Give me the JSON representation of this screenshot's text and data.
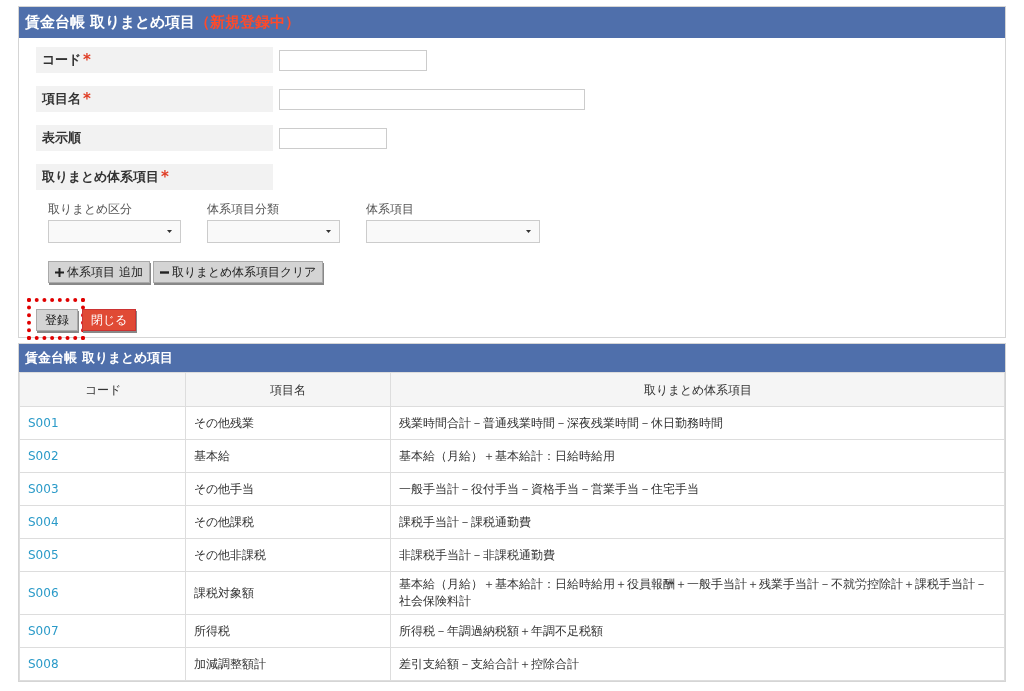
{
  "form_panel": {
    "title": "賃金台帳 取りまとめ項目",
    "status": "（新規登録中）",
    "fields": [
      {
        "label": "コード",
        "required_mark": "*",
        "kind": "input"
      },
      {
        "label": "項目名",
        "required_mark": "*",
        "kind": "input"
      },
      {
        "label": "表示順",
        "kind": "input"
      },
      {
        "label": "取りまとめ体系項目",
        "required_mark": "*",
        "kind": "group"
      }
    ],
    "selects": [
      {
        "label": "取りまとめ区分"
      },
      {
        "label": "体系項目分類"
      },
      {
        "label": "体系項目"
      }
    ],
    "action_buttons": [
      {
        "label": "体系項目 追加",
        "kind": "add"
      },
      {
        "label": "取りまとめ体系項目クリア",
        "kind": "clear"
      }
    ],
    "footer_buttons": [
      {
        "label": "登録",
        "kind": "default",
        "highlighted": true
      },
      {
        "label": "閉じる",
        "kind": "danger",
        "highlighted": false
      }
    ]
  },
  "list_panel": {
    "title": "賃金台帳 取りまとめ項目",
    "columns": [
      "コード",
      "項目名",
      "取りまとめ体系項目"
    ],
    "rows": [
      {
        "code": "S001",
        "name": "その他残業",
        "formula": "残業時間合計－普通残業時間－深夜残業時間－休日勤務時間"
      },
      {
        "code": "S002",
        "name": "基本給",
        "formula": "基本給（月給）＋基本給計：日給時給用"
      },
      {
        "code": "S003",
        "name": "その他手当",
        "formula": "一般手当計－役付手当－資格手当－営業手当－住宅手当"
      },
      {
        "code": "S004",
        "name": "その他課税",
        "formula": "課税手当計－課税通勤費"
      },
      {
        "code": "S005",
        "name": "その他非課税",
        "formula": "非課税手当計－非課税通勤費"
      },
      {
        "code": "S006",
        "name": "課税対象額",
        "formula": "基本給（月給）＋基本給計：日給時給用＋役員報酬＋一般手当計＋残業手当計－不就労控除計＋課税手当計－社会保険料計"
      },
      {
        "code": "S007",
        "name": "所得税",
        "formula": "所得税－年調過納税額＋年調不足税額"
      },
      {
        "code": "S008",
        "name": "加減調整額計",
        "formula": "差引支給額－支給合計＋控除合計"
      }
    ]
  }
}
